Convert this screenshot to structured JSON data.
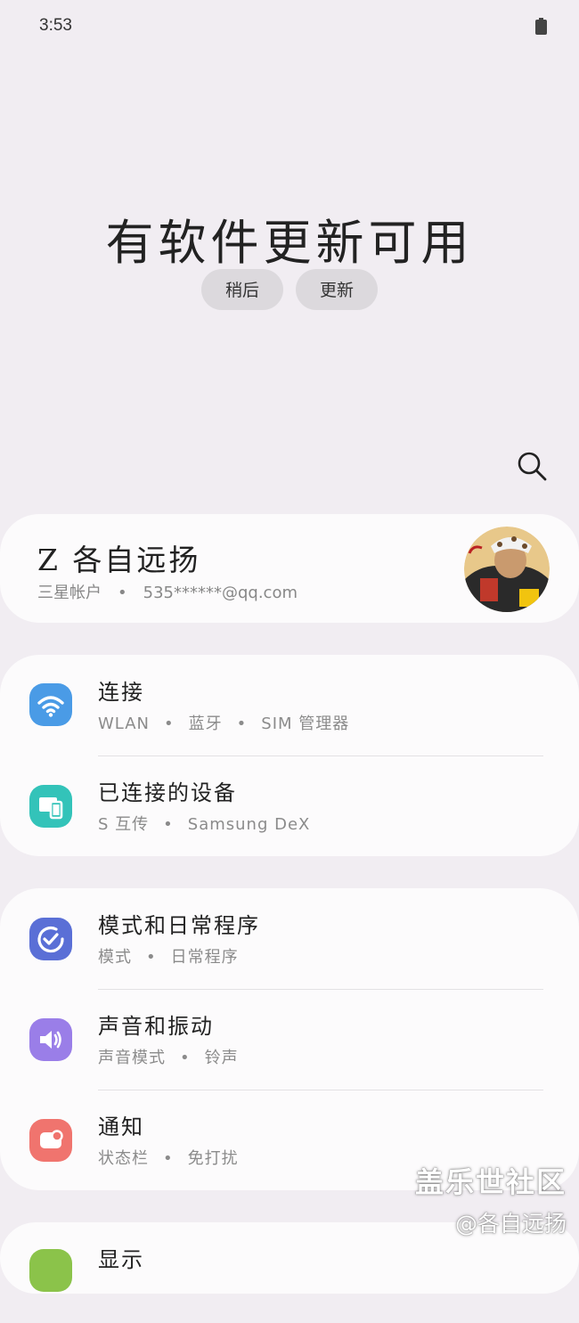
{
  "status_bar": {
    "time": "3:53"
  },
  "update_banner": {
    "title": "有软件更新可用",
    "later_label": "稍后",
    "update_label": "更新"
  },
  "account": {
    "name": "Z 各自远扬",
    "type": "三星帐户",
    "separator": "•",
    "email": "535******@qq.com"
  },
  "settings": [
    {
      "title": "连接",
      "subs": [
        "WLAN",
        "蓝牙",
        "SIM 管理器"
      ],
      "icon": "wifi-icon",
      "color": "#4a9be6"
    },
    {
      "title": "已连接的设备",
      "subs": [
        "S 互传",
        "Samsung DeX"
      ],
      "icon": "devices-icon",
      "color": "#33c3b9"
    },
    {
      "title": "模式和日常程序",
      "subs": [
        "模式",
        "日常程序"
      ],
      "icon": "check-circle-icon",
      "color": "#5a6fd6"
    },
    {
      "title": "声音和振动",
      "subs": [
        "声音模式",
        "铃声"
      ],
      "icon": "speaker-icon",
      "color": "#9a7ee8"
    },
    {
      "title": "通知",
      "subs": [
        "状态栏",
        "免打扰"
      ],
      "icon": "notification-icon",
      "color": "#f0746e"
    },
    {
      "title": "显示",
      "subs": [],
      "icon": "display-icon",
      "color": "#8bc34a"
    }
  ],
  "watermark": {
    "line1": "盖乐世社区",
    "line2": "@各自远扬"
  }
}
